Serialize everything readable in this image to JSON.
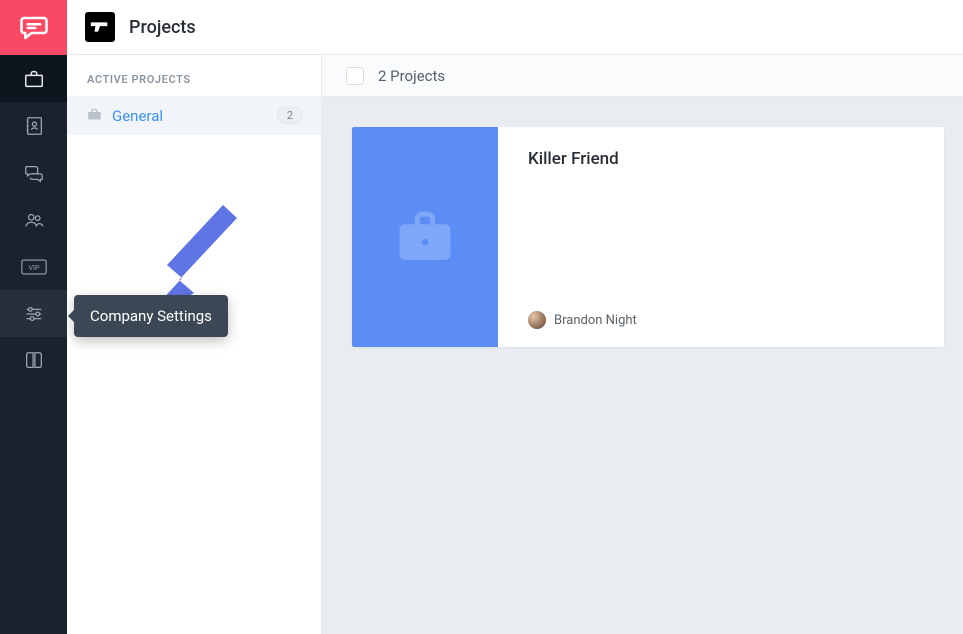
{
  "header": {
    "title": "Projects"
  },
  "sidebar_panel": {
    "heading": "ACTIVE PROJECTS",
    "items": [
      {
        "label": "General",
        "count": "2"
      }
    ]
  },
  "content": {
    "project_count_label": "2 Projects",
    "cards": [
      {
        "title": "Killer Friend",
        "author": "Brandon Night"
      }
    ]
  },
  "tooltip": {
    "text": "Company Settings"
  },
  "colors": {
    "brand": "#f94964",
    "rail": "#1a222d",
    "accent": "#5b8df5",
    "link": "#3d91f2",
    "tooltip": "#3c4755"
  }
}
